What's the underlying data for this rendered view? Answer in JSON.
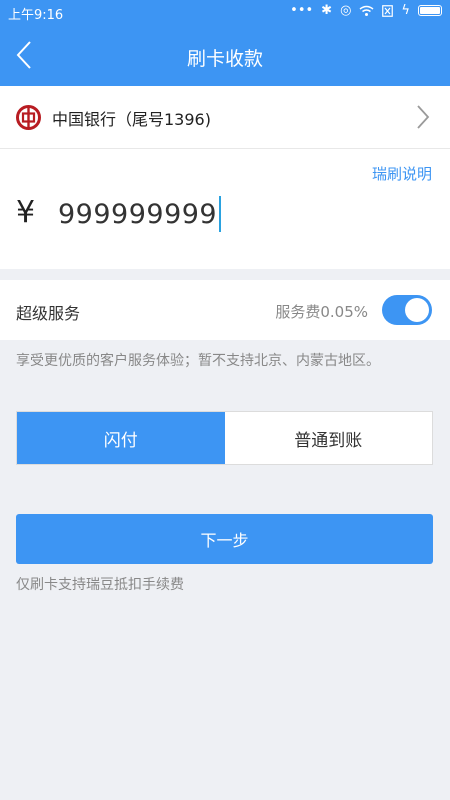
{
  "status_bar": {
    "time": "上午9:16",
    "icons": [
      "dots-icon",
      "bluetooth-icon",
      "alarm-icon",
      "wifi-icon",
      "sim-icon",
      "charging-icon",
      "battery-icon"
    ]
  },
  "nav": {
    "title": "刷卡收款"
  },
  "bank": {
    "name": "中国银行（尾号1396)"
  },
  "amount": {
    "help_link": "瑞刷说明",
    "currency_symbol": "¥",
    "value": "999999999"
  },
  "super_service": {
    "label": "超级服务",
    "fee": "服务费0.05%",
    "enabled": true
  },
  "note": "享受更优质的客户服务体验；暂不支持北京、内蒙古地区。",
  "settlement": {
    "options": [
      "闪付",
      "普通到账"
    ],
    "selected": 0
  },
  "next_button": "下一步",
  "footnote": "仅刷卡支持瑞豆抵扣手续费",
  "colors": {
    "primary": "#3d95f3",
    "bank_red": "#b81c22",
    "caret": "#2aa2e0"
  }
}
